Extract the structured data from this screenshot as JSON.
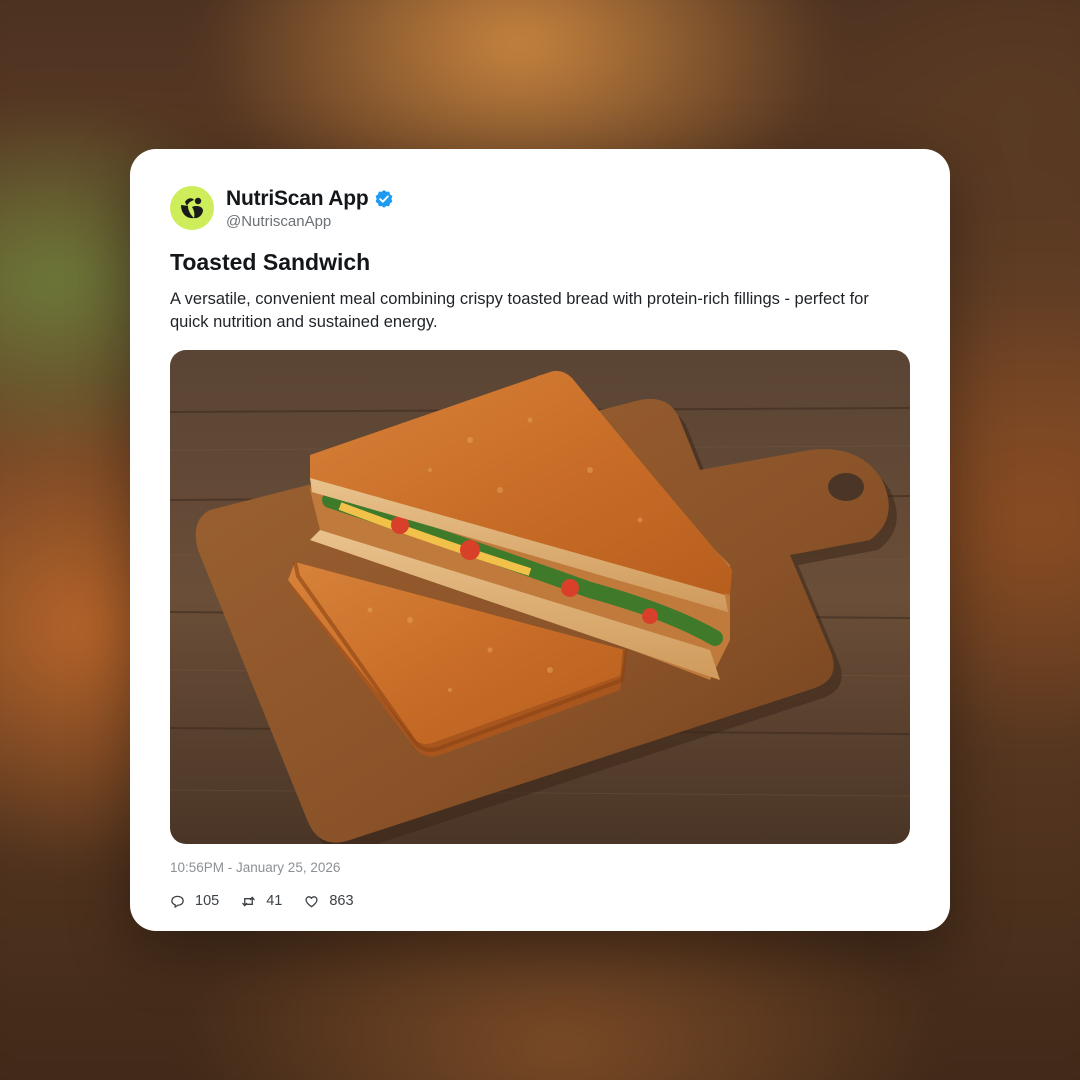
{
  "account": {
    "name": "NutriScan App",
    "handle": "@NutriscanApp",
    "verified": true,
    "avatar_color": "#cdee5a",
    "verified_color": "#1d9bf0"
  },
  "post": {
    "title": "Toasted Sandwich",
    "description": "A versatile, convenient meal combining crispy toasted bread with protein-rich fillings - perfect for quick nutrition and sustained energy.",
    "timestamp": "10:56PM - January 25, 2026",
    "image_icon": "toasted-sandwich-photo"
  },
  "stats": {
    "replies": "105",
    "reposts": "41",
    "likes": "863"
  },
  "icons": {
    "reply": "speech-bubble-icon",
    "repost": "repost-arrows-icon",
    "like": "heart-icon"
  }
}
